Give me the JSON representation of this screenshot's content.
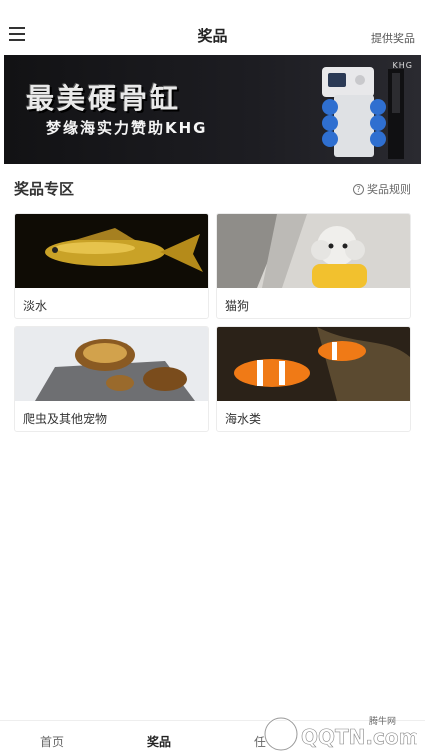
{
  "header": {
    "title": "奖品",
    "right_label": "提供奖品"
  },
  "banner": {
    "title": "最美硬骨缸",
    "subtitle": "梦缘海实力赞助KHG",
    "brand": "KHG"
  },
  "section": {
    "title": "奖品专区",
    "rules_label": "奖品规则"
  },
  "categories": [
    {
      "label": "淡水"
    },
    {
      "label": "猫狗"
    },
    {
      "label": "爬虫及其他宠物"
    },
    {
      "label": "海水类"
    }
  ],
  "tabbar": {
    "tabs": [
      {
        "label": "首页"
      },
      {
        "label": "奖品"
      },
      {
        "label": "任"
      }
    ]
  },
  "watermark": {
    "text": "QQTN.com",
    "site": "腾牛网"
  }
}
